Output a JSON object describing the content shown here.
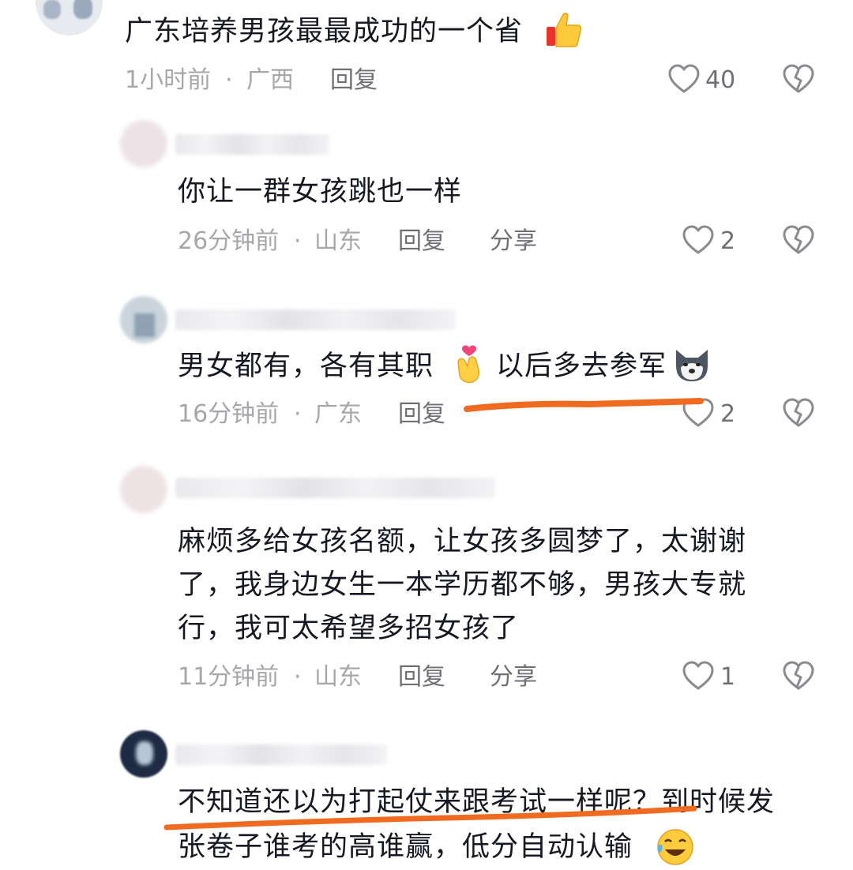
{
  "comments": [
    {
      "text": "广东培养男孩最最成功的一个省",
      "time": "1小时前",
      "location": "广西",
      "reply_label": "回复",
      "likes": "40",
      "emoji_icon": "thumbs-up-icon"
    },
    {
      "text": "你让一群女孩跳也一样",
      "time": "26分钟前",
      "location": "山东",
      "reply_label": "回复",
      "share_label": "分享",
      "likes": "2"
    },
    {
      "text_part1": "男女都有，各有其职",
      "text_part2": "以后多去参军",
      "time": "16分钟前",
      "location": "广东",
      "reply_label": "回复",
      "likes": "2",
      "emoji_icons": [
        "finger-heart-icon",
        "dog-face-icon"
      ]
    },
    {
      "lines": [
        "麻烦多给女孩名额，让女孩多圆梦了，太谢谢",
        "了，我身边女生一本学历都不够，男孩大专就",
        "行，我可太希望多招女孩了"
      ],
      "time": "11分钟前",
      "location": "山东",
      "reply_label": "回复",
      "share_label": "分享",
      "likes": "1"
    },
    {
      "lines": [
        "不知道还以为打起仗来跟考试一样呢？到时候发",
        "张卷子谁考的高谁赢，低分自动认输"
      ],
      "emoji_icon": "laughing-tears-icon"
    }
  ],
  "meta_separator": "·",
  "colors": {
    "text": "#161823",
    "meta": "#a6a7ab",
    "action": "#6f7075",
    "highlight_underline": "#f06a1f"
  }
}
